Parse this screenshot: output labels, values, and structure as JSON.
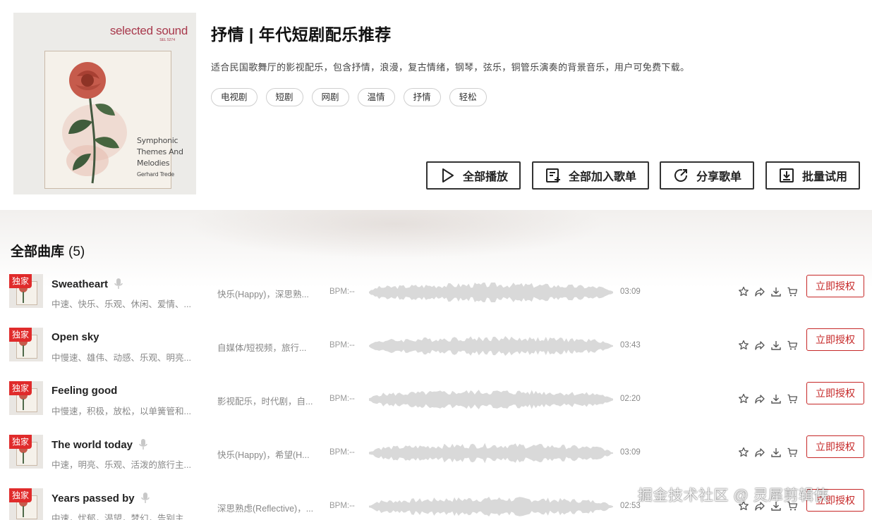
{
  "playlist": {
    "cover": {
      "brand": "selected sound",
      "catalog": "SEL 5274",
      "line1": "Symphonic",
      "line2": "Themes And",
      "line3": "Melodies",
      "artist": "Gerhard Trede"
    },
    "title": "抒情 | 年代短剧配乐推荐",
    "description": "适合民国歌舞厅的影视配乐，包含抒情，浪漫，复古情绪，钢琴，弦乐，铜管乐演奏的背景音乐，用户可免费下载。",
    "tags": [
      "电视剧",
      "短剧",
      "网剧",
      "温情",
      "抒情",
      "轻松"
    ]
  },
  "actions": {
    "play_all": "全部播放",
    "add_all": "全部加入歌单",
    "share": "分享歌单",
    "batch_try": "批量试用"
  },
  "library": {
    "title": "全部曲库",
    "count": "(5)"
  },
  "badge_label": "独家",
  "license_label": "立即授权",
  "songs": [
    {
      "title": "Sweatheart",
      "has_vocal_icon": true,
      "subtitle": "中速、快乐、乐观、休闲、爱情、...",
      "mood": "快乐(Happy)，深思熟...",
      "bpm": "BPM:--",
      "duration": "03:09"
    },
    {
      "title": "Open sky",
      "has_vocal_icon": false,
      "subtitle": "中慢速、雄伟、动感、乐观、明亮...",
      "mood": "自媒体/短视频，旅行...",
      "bpm": "BPM:--",
      "duration": "03:43"
    },
    {
      "title": "Feeling good",
      "has_vocal_icon": false,
      "subtitle": "中慢速，积极，放松，以单簧管和...",
      "mood": "影视配乐，时代剧，自...",
      "bpm": "BPM:--",
      "duration": "02:20"
    },
    {
      "title": "The world today",
      "has_vocal_icon": true,
      "subtitle": "中速，明亮、乐观、活泼的旅行主...",
      "mood": "快乐(Happy)，希望(H...",
      "bpm": "BPM:--",
      "duration": "03:09"
    },
    {
      "title": "Years passed by",
      "has_vocal_icon": true,
      "subtitle": "中速，忧郁，渴望，梦幻，告别主...",
      "mood": "深思熟虑(Reflective)，...",
      "bpm": "BPM:--",
      "duration": "02:53"
    }
  ],
  "watermark": "掘金技术社区 @ 灵犀剪辑侠",
  "colors": {
    "accent": "#c62828",
    "badge": "#e02b2b",
    "waveform": "#d9d9d9"
  },
  "icons": [
    "play-icon",
    "add-to-playlist-icon",
    "share-icon",
    "download-box-icon",
    "star-icon",
    "share-arrow-icon",
    "download-icon",
    "cart-icon",
    "mic-icon"
  ]
}
